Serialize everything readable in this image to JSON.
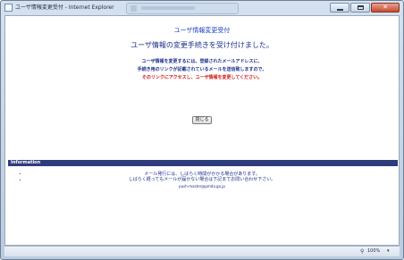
{
  "window": {
    "title": "ユーザ情報変更受付 - Internet Explorer",
    "close_glyph": "✕"
  },
  "page": {
    "title": "ユーザ情報変更受付",
    "heading": "ユーザ情報の変更手続きを受け付けました。",
    "message_lines": [
      "ユーザ情報を変更するには、登録されたメールアドレスに、",
      "手続き用のリンクが記載されているメールを送信致しますので、",
      "そのリンクにアクセスし、ユーザ情報を変更してください。"
    ],
    "close_button": "閉じる"
  },
  "info": {
    "label": "Information",
    "lines": [
      "メール発行には、しばらく時間がかかる場合があります。",
      "しばらく経ってもメールが届かない場合は下記までお問い合わせ下さい。"
    ],
    "contact": "push-master@pmda.go.jp"
  },
  "statusbar": {
    "zoom": "100%",
    "zoom_icon": "zoom-icon"
  },
  "colors": {
    "accent_blue": "#1f3fc4",
    "warning_red": "#d41414",
    "info_bar": "#2e3c7c"
  }
}
